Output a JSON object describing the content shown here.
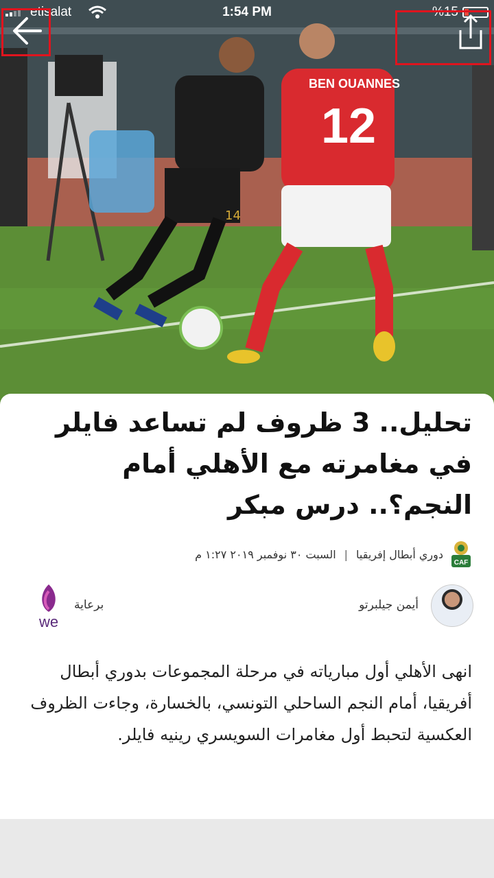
{
  "status_bar": {
    "carrier": "etisalat",
    "time": "1:54 PM",
    "battery": "%15"
  },
  "hero": {
    "player_shirt_name": "BEN OUANNES",
    "player_shirt_number": "12",
    "player2_shorts_number": "14"
  },
  "article": {
    "title": "تحليل.. 3 ظروف لم تساعد فايلر في مغامرته مع الأهلي أمام النجم؟.. درس مبكر",
    "category": "دوري أبطال إفريقيا",
    "date": "السبت ٣٠ نوفمبر ٢٠١٩ ١:٢٧ م",
    "caf_logo_text": "CAF",
    "author": "أيمن جيلبرتو",
    "sponsor_label": "برعاية",
    "sponsor_logo_text": "we",
    "body": "انهى الأهلي أول مبارياته في مرحلة المجموعات بدوري أبطال أفريقيا، أمام النجم الساحلي التونسي، بالخسارة، وجاءت الظروف العكسية لتحبط أول مغامرات السويسري رينيه فايلر."
  },
  "icons": {
    "back": "arrow-left-icon",
    "share": "share-icon",
    "wifi": "wifi-icon"
  },
  "colors": {
    "highlight": "#e0141e",
    "sponsor": "#8a2a8e"
  }
}
